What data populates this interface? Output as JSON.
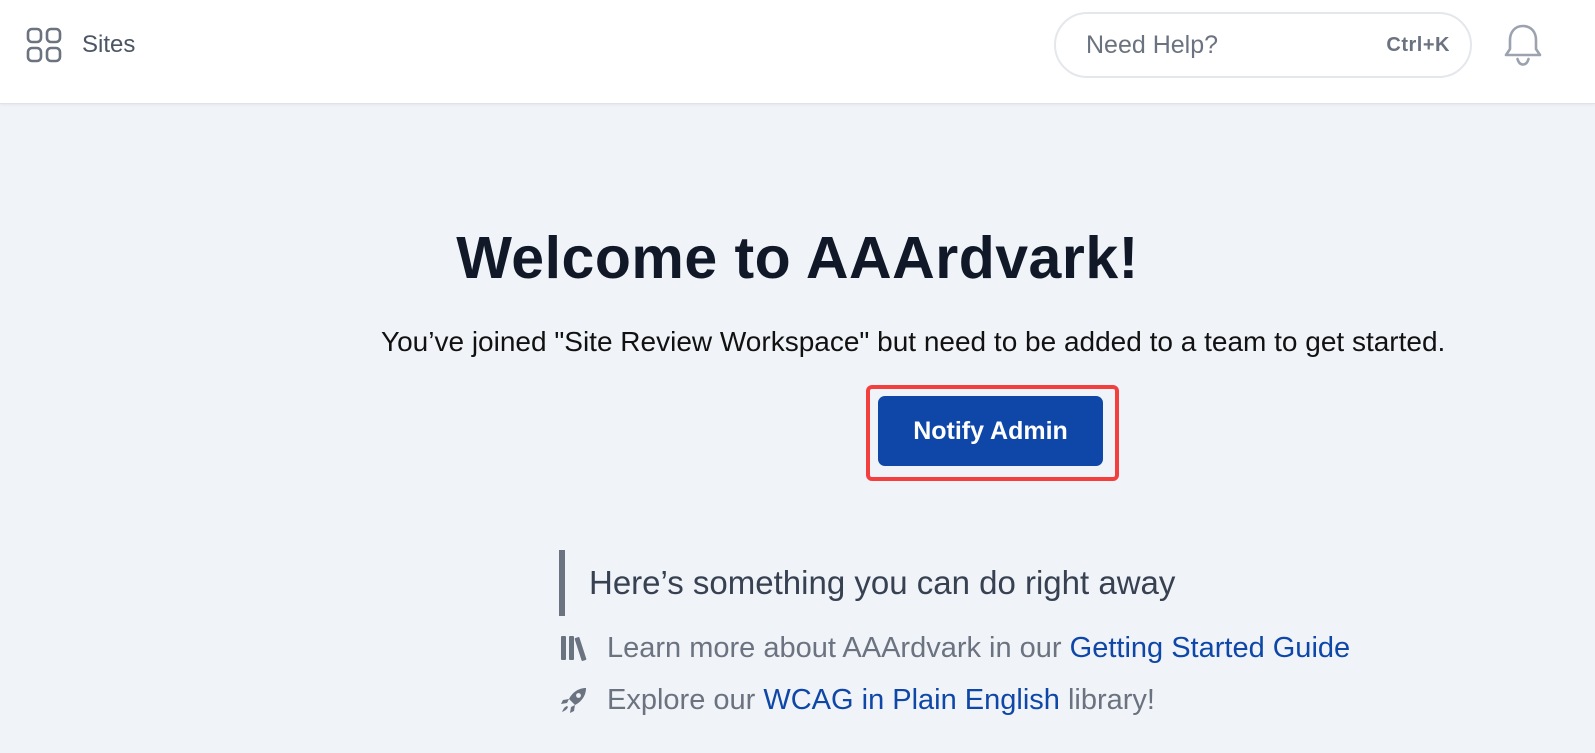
{
  "header": {
    "sites_label": "Sites",
    "sites_icon": "grid-icon",
    "help_placeholder": "Need Help?",
    "help_shortcut": "Ctrl+K",
    "bell_icon": "bell-icon"
  },
  "main": {
    "title": "Welcome to AAArdvark!",
    "subtitle": "You’ve joined \"Site Review Workspace\" but need to be added to a team to get started.",
    "notify_label": "Notify Admin",
    "callout": "Here’s something you can do right away",
    "tip1": {
      "icon": "books-icon",
      "prefix": "Learn more about AAArdvark in our ",
      "link": "Getting Started Guide"
    },
    "tip2": {
      "icon": "rocket-icon",
      "prefix": "Explore our ",
      "link": "WCAG in Plain English",
      "suffix": " library!"
    }
  },
  "colors": {
    "accent": "#0e47a8",
    "highlight": "#f43f3f",
    "background": "#f0f4f8"
  }
}
